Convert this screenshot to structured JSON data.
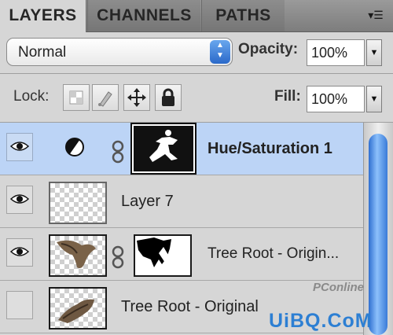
{
  "tabs": [
    {
      "label": "LAYERS",
      "active": true
    },
    {
      "label": "CHANNELS",
      "active": false
    },
    {
      "label": "PATHS",
      "active": false
    }
  ],
  "panel_menu_icon": "panel-menu-icon",
  "blend_mode": {
    "value": "Normal"
  },
  "opacity": {
    "label": "Opacity:",
    "value": "100%"
  },
  "lock": {
    "label": "Lock:",
    "icons": [
      "lock-transparent-pixels-icon",
      "lock-image-pixels-icon",
      "lock-position-icon",
      "lock-all-icon"
    ]
  },
  "fill": {
    "label": "Fill:",
    "value": "100%"
  },
  "layers": [
    {
      "name": "Hue/Saturation 1",
      "visible": true,
      "selected": true,
      "type": "adjustment"
    },
    {
      "name": "Layer 7",
      "visible": true,
      "selected": false,
      "type": "pixel"
    },
    {
      "name": "Tree Root - Origin...",
      "visible": true,
      "selected": false,
      "type": "masked"
    },
    {
      "name": "Tree Root - Original",
      "visible": false,
      "selected": false,
      "type": "pixel"
    }
  ],
  "watermark": {
    "line1": "PConline",
    "line2": "UiBQ.CoM"
  },
  "colors": {
    "selection": "#bcd4f6",
    "accent": "#2a69c9"
  }
}
